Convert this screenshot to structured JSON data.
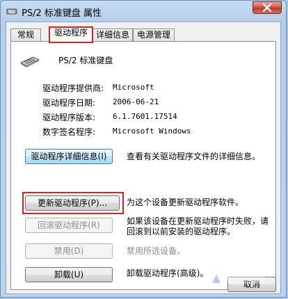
{
  "window": {
    "title": "PS/2 标准键盘 属性"
  },
  "tabs": [
    {
      "label": "常规"
    },
    {
      "label": "驱动程序"
    },
    {
      "label": "详细信息"
    },
    {
      "label": "电源管理"
    }
  ],
  "device": {
    "name": "PS/2 标准键盘"
  },
  "info": [
    {
      "label": "驱动程序提供商:",
      "value": "Microsoft"
    },
    {
      "label": "驱动程序日期:",
      "value": "2006-06-21"
    },
    {
      "label": "驱动程序版本:",
      "value": "6.1.7601.17514"
    },
    {
      "label": "数字签名程序:",
      "value": "Microsoft Windows"
    }
  ],
  "actions": [
    {
      "label": "驱动程序详细信息(I)",
      "desc": "查看有关驱动程序文件的详细信息。"
    },
    {
      "label": "更新驱动程序(P)...",
      "desc": "为这个设备更新驱动程序软件。"
    },
    {
      "label": "回滚驱动程序(R)",
      "desc_line1": "如果该设备在更新驱动程序时失败，请",
      "desc_line2": "回滚到以前安装的驱动程序。"
    },
    {
      "label": "禁用(D)",
      "desc": "禁用所选设备。"
    },
    {
      "label": "卸载(U)",
      "desc": "卸载驱动程序(高级)。"
    }
  ],
  "bottom": {
    "cancel_label": "取消"
  },
  "colors": {
    "highlight": "#e02020"
  }
}
